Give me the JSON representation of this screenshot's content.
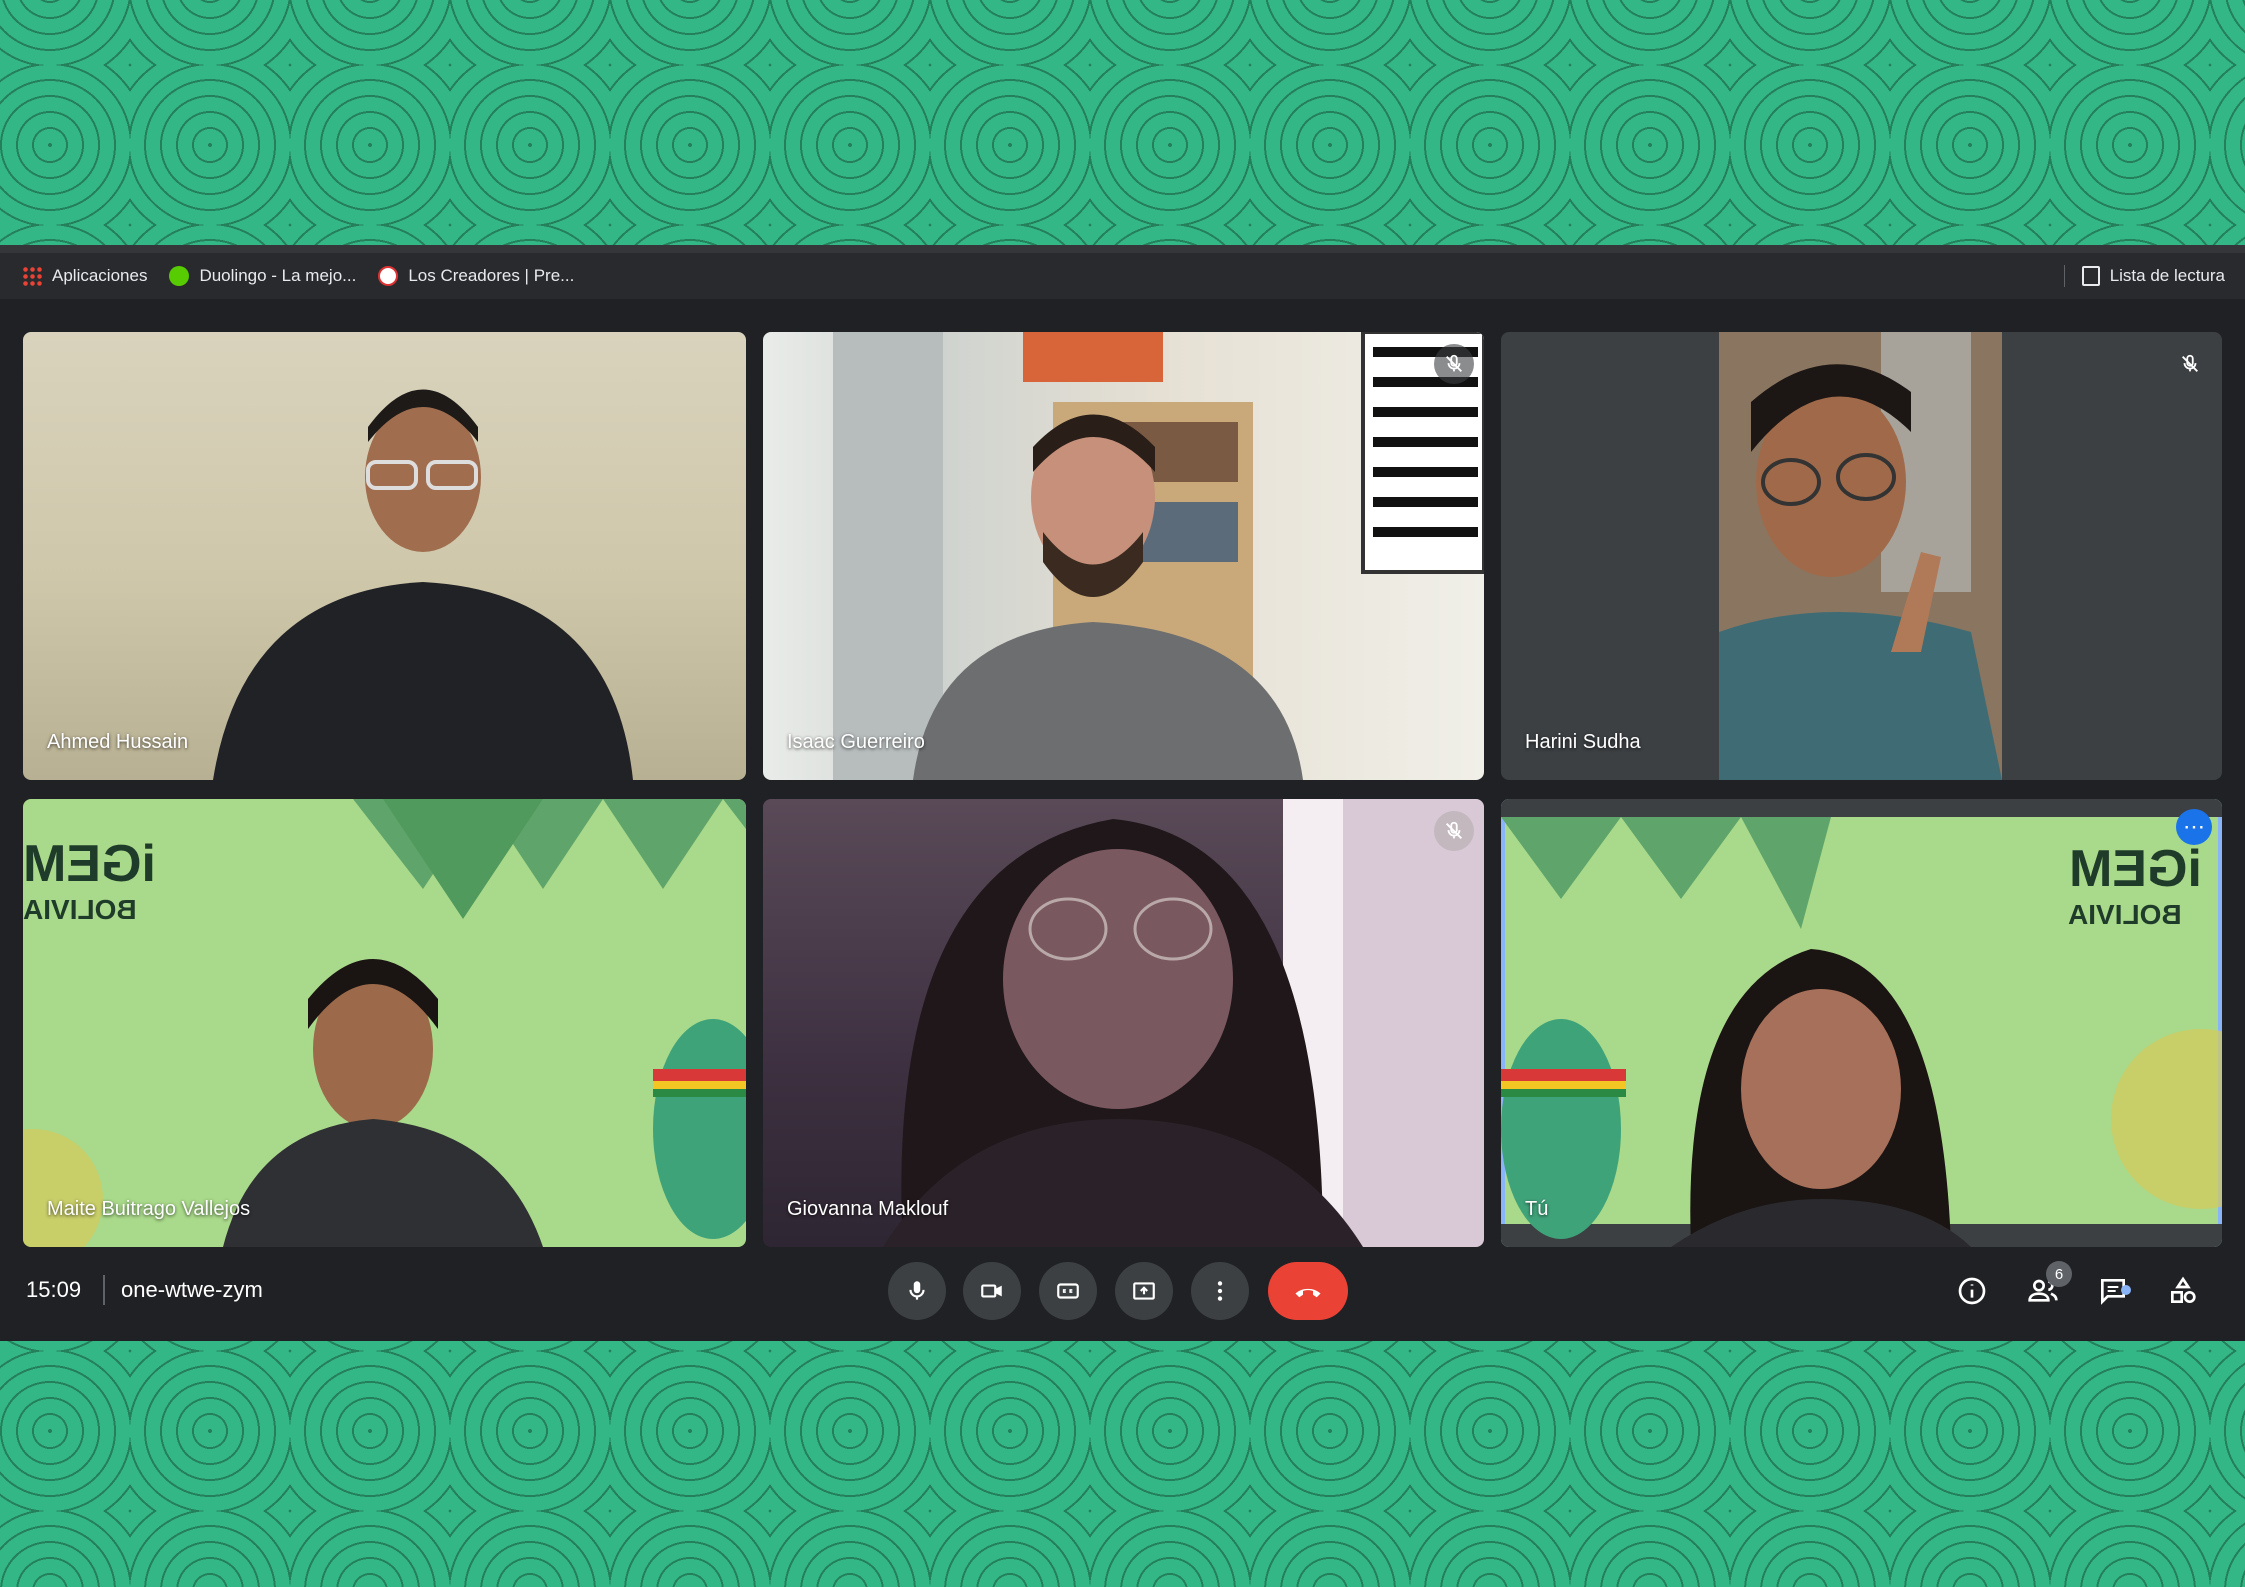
{
  "bookmarks": {
    "items": [
      {
        "label": "Aplicaciones",
        "icon": "apps-grid-icon"
      },
      {
        "label": "Duolingo - La mejo...",
        "icon": "duolingo-icon"
      },
      {
        "label": "Los Creadores | Pre...",
        "icon": "creadores-icon"
      }
    ],
    "reading_list": "Lista de lectura"
  },
  "participants": [
    {
      "name": "Ahmed Hussain",
      "muted": false
    },
    {
      "name": "Isaac Guerreiro",
      "muted": true
    },
    {
      "name": "Harini Sudha",
      "muted": true
    },
    {
      "name": "Maite Buitrago Vallejos",
      "muted": false
    },
    {
      "name": "Giovanna Maklouf",
      "muted": true
    },
    {
      "name": "Tú",
      "muted": false
    }
  ],
  "background_logo": {
    "line1": "iGEM",
    "line2": "BOLIVIA"
  },
  "meeting": {
    "time": "15:09",
    "code": "one-wtwe-zym",
    "people_count": "6"
  },
  "colors": {
    "page_green": "#34b787",
    "hangup_red": "#ea4335",
    "active_border": "#8ab4f8",
    "toolbar_bg": "#202124"
  }
}
